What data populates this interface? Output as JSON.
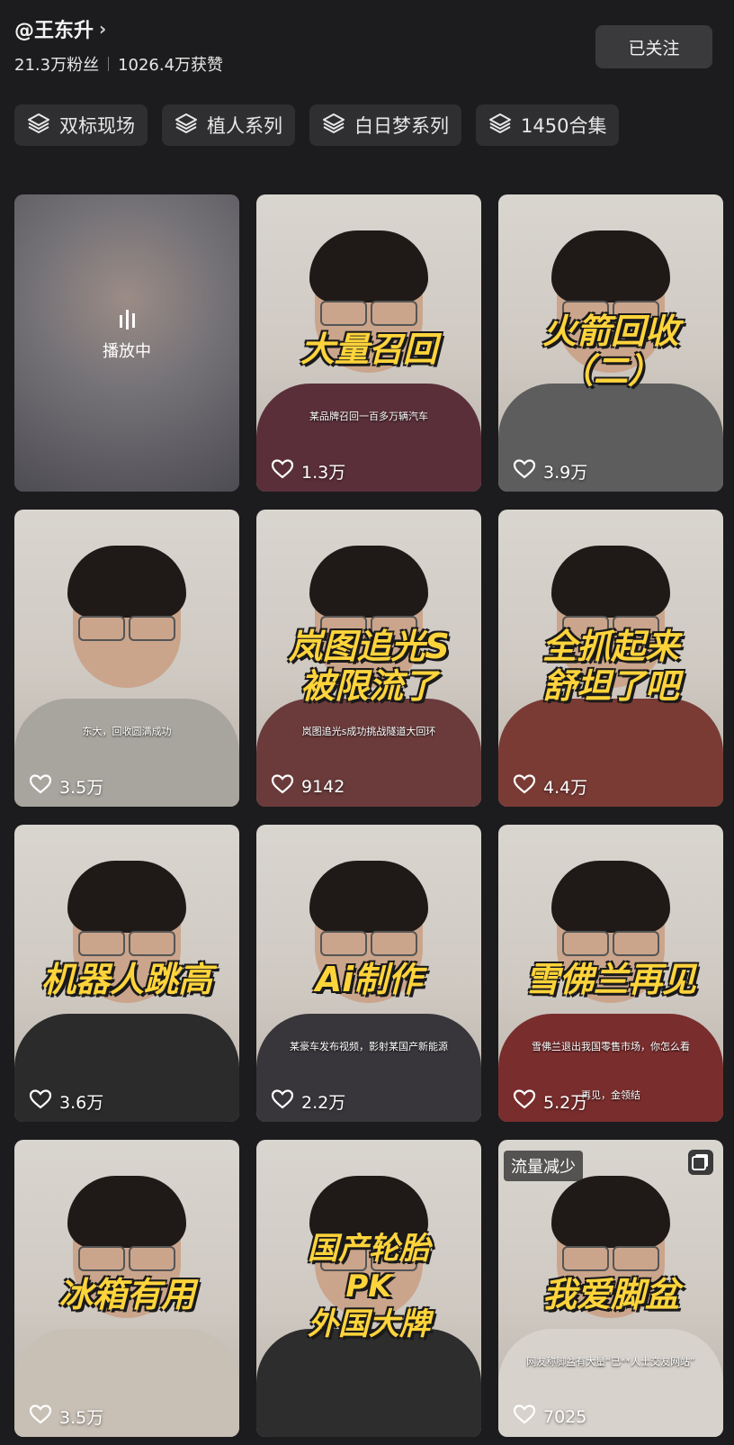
{
  "profile": {
    "name": "@王东升",
    "fans": "21.3万粉丝",
    "likes": "1026.4万获赞",
    "follow_label": "已关注"
  },
  "collections": [
    {
      "label": "双标现场",
      "icon": "collection-stack-icon"
    },
    {
      "label": "植人系列",
      "icon": "collection-stack-icon"
    },
    {
      "label": "白日梦系列",
      "icon": "collection-stack-icon"
    },
    {
      "label": "1450合集",
      "icon": "collection-stack-icon"
    }
  ],
  "videos": [
    {
      "state": "playing",
      "playing_label": "播放中"
    },
    {
      "caption": "大量召回",
      "likes": "1.3万",
      "subtitle": "某品牌召回一百多万辆汽车",
      "shirt": "#5a2f3a"
    },
    {
      "caption": "火箭回收\n（二）",
      "likes": "3.9万",
      "shirt": "#5d5d5d"
    },
    {
      "caption": "",
      "likes": "3.5万",
      "subtitle": "东大，回收圆满成功",
      "shirt": "#a8a59e"
    },
    {
      "caption": "岚图追光S\n被限流了",
      "likes": "9142",
      "subtitle": "岚图追光s成功挑战隧道大回环",
      "shirt": "#6b3b3b"
    },
    {
      "caption": "全抓起来\n舒坦了吧",
      "likes": "4.4万",
      "shirt": "#7a3b35"
    },
    {
      "caption": "机器人跳高",
      "likes": "3.6万",
      "shirt": "#2b2b2b"
    },
    {
      "caption": "Ai制作",
      "likes": "2.2万",
      "subtitle": "某豪车发布视频，影射某国产新能源",
      "shirt": "#38363a"
    },
    {
      "caption": "雪佛兰再见",
      "likes": "5.2万",
      "subtitle": "雪佛兰退出我国零售市场，你怎么看",
      "subtitle2": "再见，金领结",
      "shirt": "#7a2d2d"
    },
    {
      "caption": "冰箱有用",
      "likes": "3.5万",
      "shirt": "#c8bfb5"
    },
    {
      "caption": "国产轮胎\nPK\n外国大牌",
      "likes": "",
      "shirt": "#2d2d2d"
    },
    {
      "caption": "我爱脚盆",
      "likes": "7025",
      "tag": "流量减少",
      "subtitle": "网友称脚盆有大量“已**人士交友网站”",
      "multi": true,
      "shirt": "#d8d2cc"
    }
  ],
  "colors": {
    "background": "#1c1c1e",
    "caption_yellow": "#ffd43b",
    "chip_bg": "#2f2f31"
  }
}
